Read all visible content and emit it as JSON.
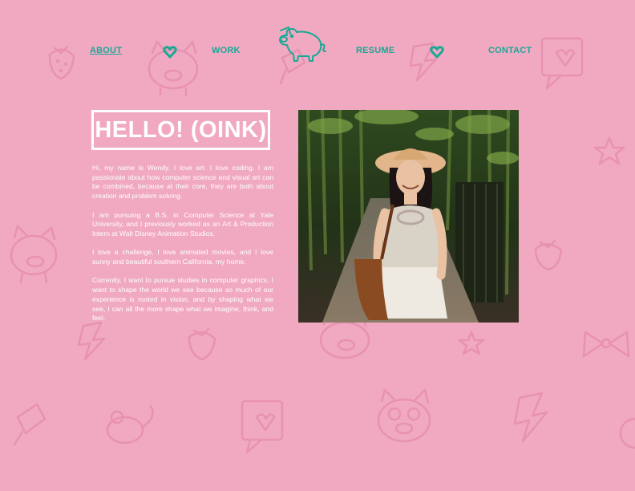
{
  "nav": {
    "items": [
      {
        "label": "ABOUT",
        "active": true
      },
      {
        "label": "WORK",
        "active": false
      },
      {
        "label": "RESUME",
        "active": false
      },
      {
        "label": "CONTACT",
        "active": false
      }
    ],
    "logo_icon": "pig-logo-icon",
    "separator_icon": "heart-icon"
  },
  "intro": {
    "heading": "HELLO! (OINK)",
    "paragraphs": [
      "Hi, my name is Wendy. I love art. I love coding. I am passionate about how computer science and visual art can be combined, because at their core, they are both about creation and problem solving.",
      "I am pursuing a B.S. in Computer Science at Yale University, and I previously worked as an Art & Production Intern at Walt Disney Animation Studios.",
      "I love a challenge, I love animated movies, and I love sunny and beautiful southern California, my home.",
      "Currently, I want to pursue studies in computer graphics. I want to shape the world we see because so much of our experience is rooted in vision, and by shaping what we see, I can all the more shape what we imagine, think, and feel."
    ]
  },
  "photo": {
    "subject": "portrait-photo"
  },
  "colors": {
    "background": "#f0a9c1",
    "accent": "#1aa896",
    "doodle": "#e892b0",
    "text": "#ffffff"
  }
}
